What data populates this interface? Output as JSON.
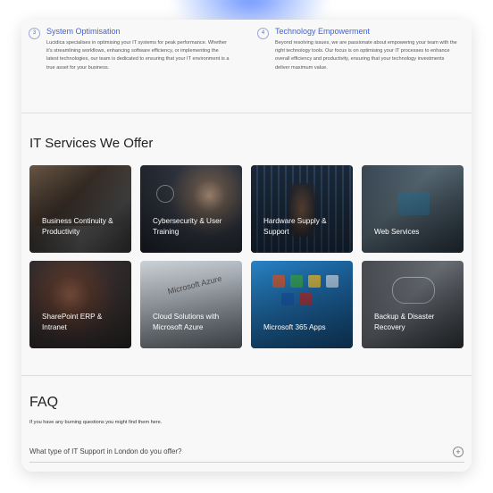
{
  "features": [
    {
      "number": "3",
      "title": "System Optimisation",
      "description": "Lucidica specialises in optimising your IT systems for peak performance. Whether it's streamlining workflows, enhancing software efficiency, or implementing the latest technologies, our team is dedicated to ensuring that your IT environment is a true asset for your business."
    },
    {
      "number": "4",
      "title": "Technology Empowerment",
      "description": "Beyond resolving issues, we are passionate about empowering your team with the right technology tools. Our focus is on optimising your IT processes to enhance overall efficiency and productivity, ensuring that your technology investments deliver maximum value."
    }
  ],
  "services": {
    "title": "IT Services We Offer",
    "items": [
      {
        "label": "Business Continuity & Productivity"
      },
      {
        "label": "Cybersecurity & User Training"
      },
      {
        "label": "Hardware Supply & Support"
      },
      {
        "label": "Web Services"
      },
      {
        "label": "SharePoint ERP & Intranet"
      },
      {
        "label": "Cloud Solutions with Microsoft Azure"
      },
      {
        "label": "Microsoft 365 Apps"
      },
      {
        "label": "Backup & Disaster Recovery"
      }
    ]
  },
  "faq": {
    "title": "FAQ",
    "subtitle": "If you have any burning questions you might find them here.",
    "questions": [
      {
        "text": "What type of IT Support in London do you offer?"
      }
    ]
  },
  "colors": {
    "accent": "#3d63dd",
    "glow": "#4a78ff"
  }
}
